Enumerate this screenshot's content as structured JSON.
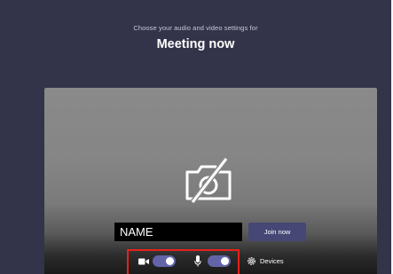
{
  "header": {
    "subtitle": "Choose your audio and video settings for",
    "title": "Meeting now"
  },
  "name_field": {
    "value": "NAME"
  },
  "join_button": {
    "label": "Join now"
  },
  "controls": {
    "video_toggle": {
      "state": "on",
      "icon": "video-camera-icon"
    },
    "audio_toggle": {
      "state": "on",
      "icon": "microphone-icon"
    },
    "devices_label": "Devices",
    "devices_icon": "gear-icon"
  },
  "preview": {
    "camera_icon": "camera-off-icon"
  },
  "colors": {
    "background": "#33344a",
    "accent": "#6264a7",
    "join_button": "#464775",
    "highlight": "#e8201a"
  }
}
